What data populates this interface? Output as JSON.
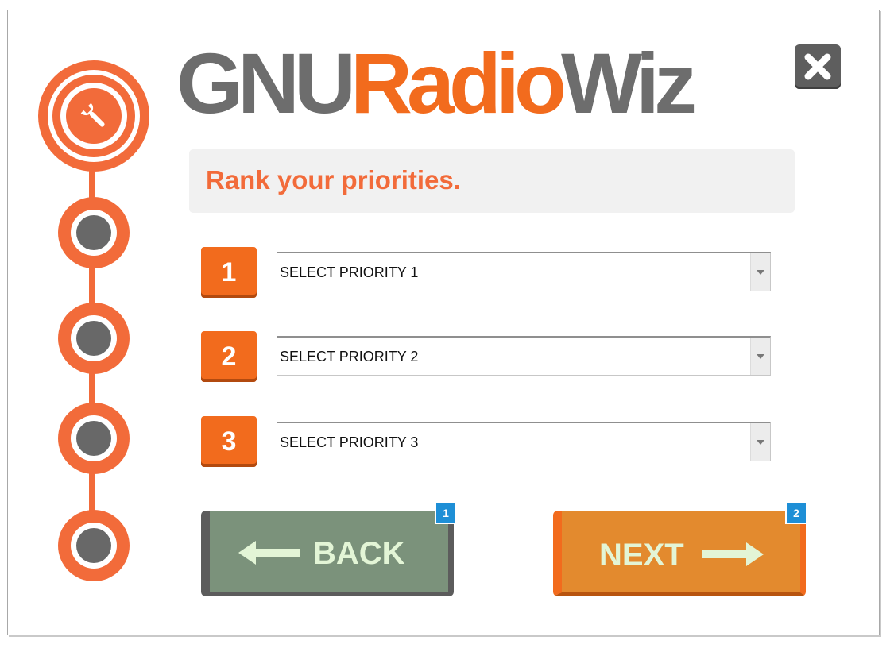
{
  "logo": {
    "part1": "GNU",
    "part2": "Radio",
    "part3": "Wiz"
  },
  "banner": {
    "text": "Rank your priorities."
  },
  "priorities": [
    {
      "number": "1",
      "selected": "SELECT PRIORITY 1"
    },
    {
      "number": "2",
      "selected": "SELECT PRIORITY 2"
    },
    {
      "number": "3",
      "selected": "SELECT PRIORITY 3"
    }
  ],
  "buttons": {
    "back": {
      "label": "BACK",
      "badge": "1"
    },
    "next": {
      "label": "NEXT",
      "badge": "2"
    }
  },
  "stepper": {
    "active_icon": "wrench-icon",
    "total_steps": 5
  },
  "colors": {
    "accent": "#f26b3a",
    "brand_orange": "#f26b1d",
    "logo_gray": "#6d6d6d",
    "back_green": "#7b927b",
    "next_orange": "#e38a2e",
    "badge_blue": "#1e8fd6"
  },
  "icons": {
    "close": "close-icon",
    "wrench": "wrench-icon",
    "left_arrow": "arrow-left-icon",
    "right_arrow": "arrow-right-icon",
    "dropdown": "chevron-down-icon"
  }
}
